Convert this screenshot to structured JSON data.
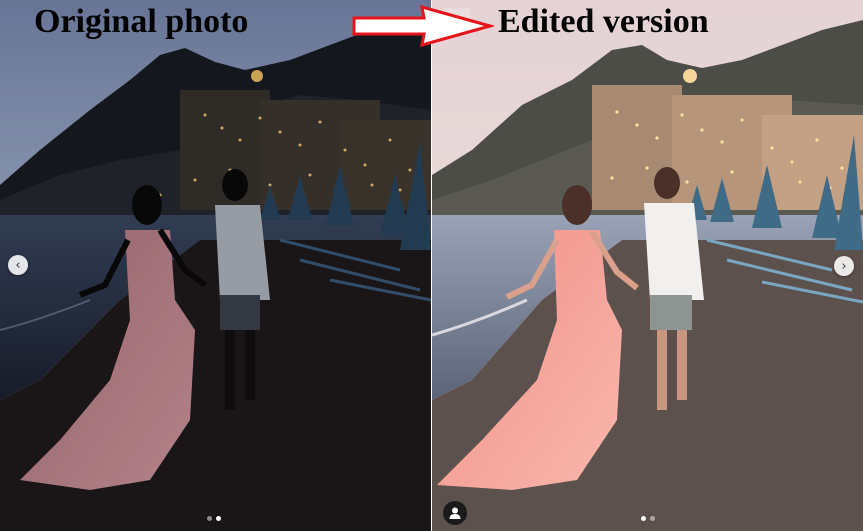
{
  "captions": {
    "original": "Original photo",
    "edited": "Edited version"
  },
  "icons": {
    "arrow": "right-arrow-icon",
    "prev": "chevron-left-icon",
    "next": "chevron-right-icon",
    "tag": "person-tag-icon",
    "bookmark": "bookmark-icon"
  },
  "colors": {
    "arrow": "#e8141b",
    "original_sky_top": "#b9c9e4",
    "edited_sky_top": "#e9d6d8",
    "dress_original": "#c98a93",
    "dress_edited": "#f3a49c"
  },
  "carousel": {
    "left_active_dot": 2,
    "right_active_dot": 1,
    "dot_count": 2
  }
}
